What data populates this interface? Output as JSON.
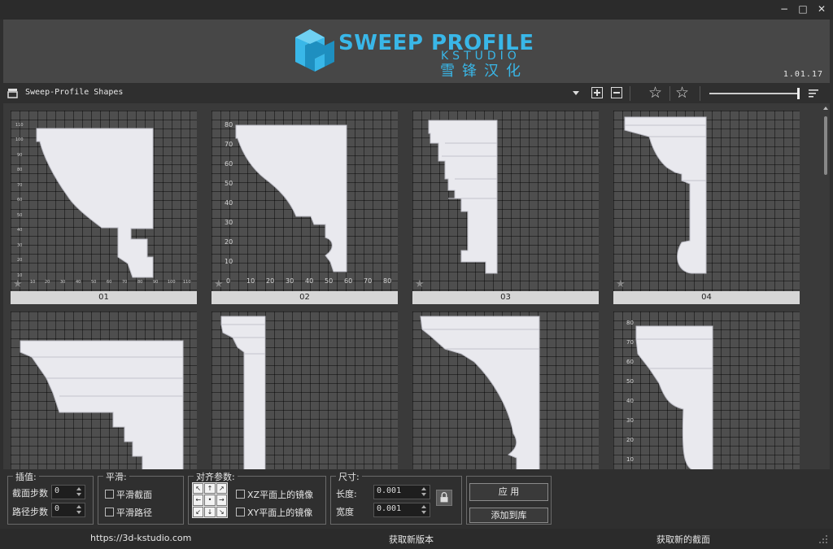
{
  "window": {
    "minimize_glyph": "−",
    "maximize_glyph": "□",
    "close_glyph": "✕"
  },
  "banner": {
    "logo_title": "SWEEP PROFILE",
    "logo_sub": "KSTUDIO",
    "logo_cn": "雪锋汉化",
    "version": "1.01.17",
    "logo_color": "#39b7e8"
  },
  "toolbar": {
    "library_name": "Sweep-Profile Shapes",
    "icons": [
      "library-icon",
      "dropdown-arrow-icon",
      "add-icon",
      "remove-icon",
      "star-icon",
      "star-list-icon",
      "zoom-slider",
      "sort-icon"
    ]
  },
  "gallery": {
    "items": [
      {
        "label": "01",
        "favorite": false
      },
      {
        "label": "02",
        "favorite": false
      },
      {
        "label": "03",
        "favorite": false
      },
      {
        "label": "04",
        "favorite": false
      },
      {
        "label": "",
        "favorite": false
      },
      {
        "label": "",
        "favorite": false
      },
      {
        "label": "",
        "favorite": false
      },
      {
        "label": "",
        "favorite": false
      }
    ],
    "axis_ticks": {
      "item1_y": [
        "110",
        "100",
        "90",
        "80",
        "70",
        "60",
        "50",
        "40",
        "30",
        "20",
        "10"
      ],
      "item1_x": [
        "10",
        "20",
        "30",
        "40",
        "50",
        "60",
        "70",
        "80",
        "90",
        "100",
        "110"
      ],
      "item2_y": [
        "80",
        "70",
        "60",
        "50",
        "40",
        "30",
        "20",
        "10",
        "0"
      ],
      "item2_x": [
        "10",
        "20",
        "30",
        "40",
        "50",
        "60",
        "70",
        "80"
      ],
      "item8_y": [
        "80",
        "70",
        "60",
        "50",
        "40",
        "30",
        "20",
        "10"
      ]
    }
  },
  "interpolation": {
    "title": "插值:",
    "section_steps_label": "截面步数",
    "section_steps_value": "0",
    "path_steps_label": "路径步数",
    "path_steps_value": "0"
  },
  "smoothing": {
    "title": "平滑:",
    "smooth_section_label": "平滑截面",
    "smooth_path_label": "平滑路径"
  },
  "alignment": {
    "title": "对齐参数:",
    "mirror_xz_label": "XZ平面上的镜像",
    "mirror_xy_label": "XY平面上的镜像"
  },
  "size": {
    "title": "尺寸:",
    "length_label": "长度:",
    "length_value": "0.001",
    "width_label": "宽度",
    "width_value": "0.001"
  },
  "actions": {
    "apply_label": "应 用",
    "add_to_library_label": "添加到库"
  },
  "status": {
    "website": "https://3d-kstudio.com",
    "get_new_version": "获取新版本",
    "get_new_profiles": "获取新的截面"
  }
}
